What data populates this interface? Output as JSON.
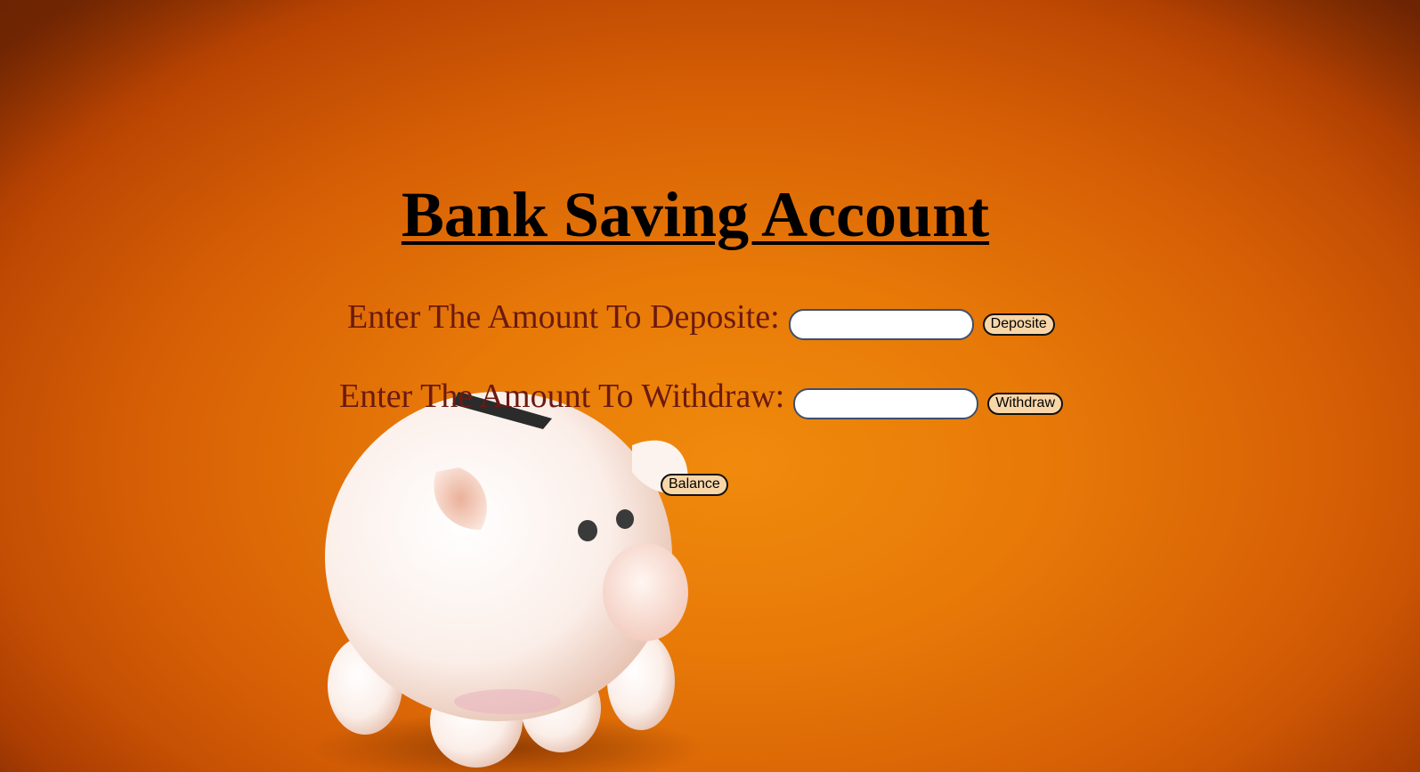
{
  "page": {
    "title": "Bank Saving Account"
  },
  "deposit": {
    "label": "Enter The Amount To Deposite:",
    "value": "",
    "button_label": "Deposite"
  },
  "withdraw": {
    "label": "Enter The Amount To Withdraw:",
    "value": "",
    "button_label": "Withdraw"
  },
  "balance": {
    "button_label": "Balance"
  },
  "background": {
    "image": "piggy-bank",
    "colors": {
      "orange_center": "#f08a0c",
      "orange_edge": "#b84302",
      "label_text": "#6b1a10",
      "button_fill": "#f8d6a8"
    }
  }
}
